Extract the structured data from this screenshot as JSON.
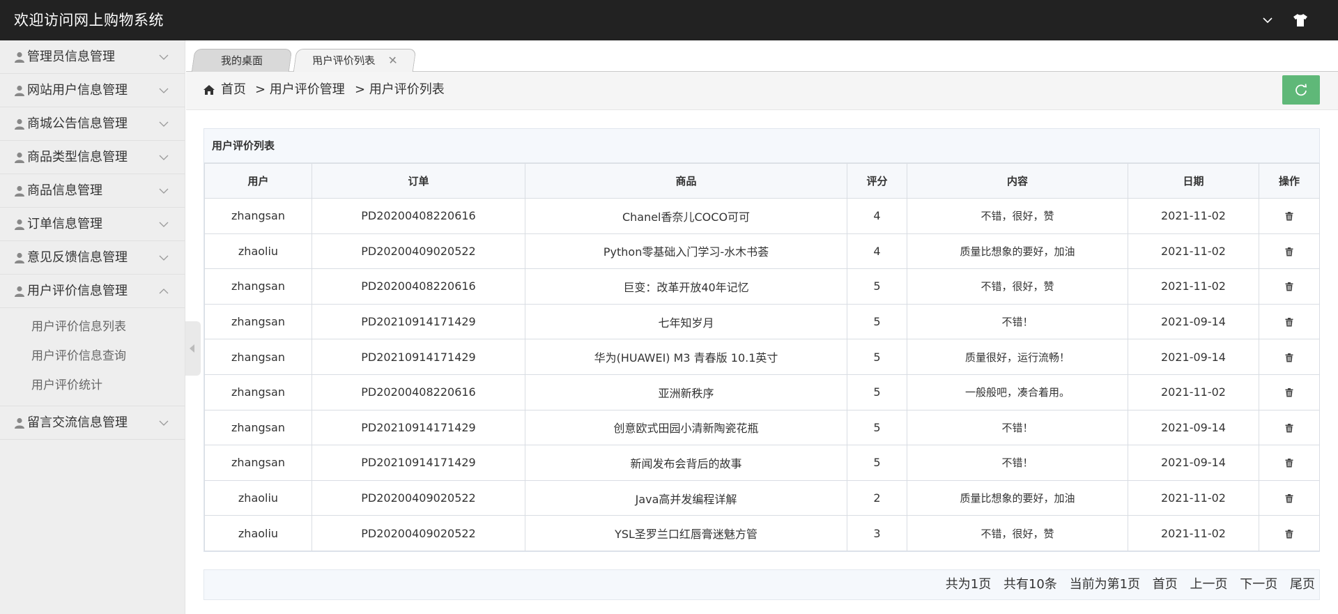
{
  "header": {
    "title": "欢迎访问网上购物系统"
  },
  "sidebar": {
    "groups": [
      {
        "label": "管理员信息管理"
      },
      {
        "label": "网站用户信息管理"
      },
      {
        "label": "商城公告信息管理"
      },
      {
        "label": "商品类型信息管理"
      },
      {
        "label": "商品信息管理"
      },
      {
        "label": "订单信息管理"
      },
      {
        "label": "意见反馈信息管理"
      },
      {
        "label": "用户评价信息管理",
        "expanded": true,
        "items": [
          "用户评价信息列表",
          "用户评价信息查询",
          "用户评价统计"
        ]
      },
      {
        "label": "留言交流信息管理"
      }
    ]
  },
  "tabs": {
    "desktop": "我的桌面",
    "current": "用户评价列表",
    "close": "✕"
  },
  "breadcrumb": {
    "home": "首页",
    "level1": "> 用户评价管理",
    "level2": "> 用户评价列表"
  },
  "table": {
    "title": "用户评价列表",
    "columns": [
      "用户",
      "订单",
      "商品",
      "评分",
      "内容",
      "日期",
      "操作"
    ],
    "rows": [
      {
        "user": "zhangsan",
        "order": "PD20200408220616",
        "product": "Chanel香奈儿COCO可可",
        "score": "4",
        "content": "不错，很好，赞",
        "date": "2021-11-02"
      },
      {
        "user": "zhaoliu",
        "order": "PD20200409020522",
        "product": "Python零基础入门学习-水木书荟",
        "score": "4",
        "content": "质量比想象的要好，加油",
        "date": "2021-11-02"
      },
      {
        "user": "zhangsan",
        "order": "PD20200408220616",
        "product": "巨变：改革开放40年记忆",
        "score": "5",
        "content": "不错，很好，赞",
        "date": "2021-11-02"
      },
      {
        "user": "zhangsan",
        "order": "PD20210914171429",
        "product": "七年知岁月",
        "score": "5",
        "content": "不错！",
        "date": "2021-09-14"
      },
      {
        "user": "zhangsan",
        "order": "PD20210914171429",
        "product": "华为(HUAWEI) M3 青春版 10.1英寸",
        "score": "5",
        "content": "质量很好，运行流畅！",
        "date": "2021-09-14"
      },
      {
        "user": "zhangsan",
        "order": "PD20200408220616",
        "product": "亚洲新秩序",
        "score": "5",
        "content": "一般般吧，凑合着用。",
        "date": "2021-11-02"
      },
      {
        "user": "zhangsan",
        "order": "PD20210914171429",
        "product": "创意欧式田园小清新陶瓷花瓶",
        "score": "5",
        "content": "不错！",
        "date": "2021-09-14"
      },
      {
        "user": "zhangsan",
        "order": "PD20210914171429",
        "product": "新闻发布会背后的故事",
        "score": "5",
        "content": "不错！",
        "date": "2021-09-14"
      },
      {
        "user": "zhaoliu",
        "order": "PD20200409020522",
        "product": "Java高并发编程详解",
        "score": "2",
        "content": "质量比想象的要好，加油",
        "date": "2021-11-02"
      },
      {
        "user": "zhaoliu",
        "order": "PD20200409020522",
        "product": "YSL圣罗兰口红唇膏迷魅方管",
        "score": "3",
        "content": "不错，很好，赞",
        "date": "2021-11-02"
      }
    ]
  },
  "pager": {
    "total_pages": "共为1页",
    "total_records": "共有10条",
    "current": "当前为第1页",
    "first": "首页",
    "prev": "上一页",
    "next": "下一页",
    "last": "尾页"
  },
  "colors": {
    "header_bg": "#222222",
    "sidebar_bg": "#eeeeee",
    "refresh_btn": "#5fb878"
  },
  "icons": {
    "top_right": [
      "chevron-down-icon",
      "shirt-icon"
    ],
    "sidebar": "user-icon",
    "breadcrumb": "home-icon",
    "refresh": "refresh-icon",
    "row_action": "trash-icon"
  }
}
